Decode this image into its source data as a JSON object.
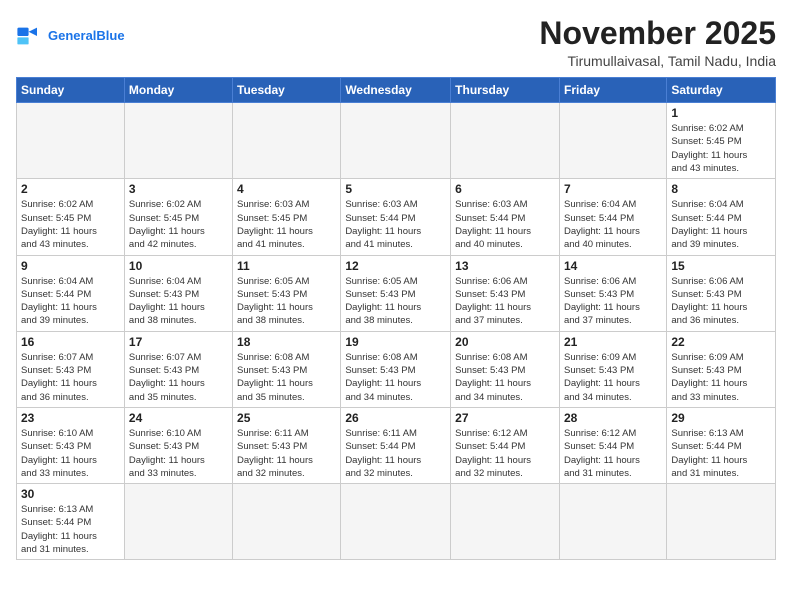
{
  "header": {
    "logo_general": "General",
    "logo_blue": "Blue",
    "month_title": "November 2025",
    "subtitle": "Tirumullaivasal, Tamil Nadu, India"
  },
  "weekdays": [
    "Sunday",
    "Monday",
    "Tuesday",
    "Wednesday",
    "Thursday",
    "Friday",
    "Saturday"
  ],
  "weeks": [
    [
      {
        "day": "",
        "info": ""
      },
      {
        "day": "",
        "info": ""
      },
      {
        "day": "",
        "info": ""
      },
      {
        "day": "",
        "info": ""
      },
      {
        "day": "",
        "info": ""
      },
      {
        "day": "",
        "info": ""
      },
      {
        "day": "1",
        "info": "Sunrise: 6:02 AM\nSunset: 5:45 PM\nDaylight: 11 hours\nand 43 minutes."
      }
    ],
    [
      {
        "day": "2",
        "info": "Sunrise: 6:02 AM\nSunset: 5:45 PM\nDaylight: 11 hours\nand 43 minutes."
      },
      {
        "day": "3",
        "info": "Sunrise: 6:02 AM\nSunset: 5:45 PM\nDaylight: 11 hours\nand 42 minutes."
      },
      {
        "day": "4",
        "info": "Sunrise: 6:03 AM\nSunset: 5:45 PM\nDaylight: 11 hours\nand 41 minutes."
      },
      {
        "day": "5",
        "info": "Sunrise: 6:03 AM\nSunset: 5:44 PM\nDaylight: 11 hours\nand 41 minutes."
      },
      {
        "day": "6",
        "info": "Sunrise: 6:03 AM\nSunset: 5:44 PM\nDaylight: 11 hours\nand 40 minutes."
      },
      {
        "day": "7",
        "info": "Sunrise: 6:04 AM\nSunset: 5:44 PM\nDaylight: 11 hours\nand 40 minutes."
      },
      {
        "day": "8",
        "info": "Sunrise: 6:04 AM\nSunset: 5:44 PM\nDaylight: 11 hours\nand 39 minutes."
      }
    ],
    [
      {
        "day": "9",
        "info": "Sunrise: 6:04 AM\nSunset: 5:44 PM\nDaylight: 11 hours\nand 39 minutes."
      },
      {
        "day": "10",
        "info": "Sunrise: 6:04 AM\nSunset: 5:43 PM\nDaylight: 11 hours\nand 38 minutes."
      },
      {
        "day": "11",
        "info": "Sunrise: 6:05 AM\nSunset: 5:43 PM\nDaylight: 11 hours\nand 38 minutes."
      },
      {
        "day": "12",
        "info": "Sunrise: 6:05 AM\nSunset: 5:43 PM\nDaylight: 11 hours\nand 38 minutes."
      },
      {
        "day": "13",
        "info": "Sunrise: 6:06 AM\nSunset: 5:43 PM\nDaylight: 11 hours\nand 37 minutes."
      },
      {
        "day": "14",
        "info": "Sunrise: 6:06 AM\nSunset: 5:43 PM\nDaylight: 11 hours\nand 37 minutes."
      },
      {
        "day": "15",
        "info": "Sunrise: 6:06 AM\nSunset: 5:43 PM\nDaylight: 11 hours\nand 36 minutes."
      }
    ],
    [
      {
        "day": "16",
        "info": "Sunrise: 6:07 AM\nSunset: 5:43 PM\nDaylight: 11 hours\nand 36 minutes."
      },
      {
        "day": "17",
        "info": "Sunrise: 6:07 AM\nSunset: 5:43 PM\nDaylight: 11 hours\nand 35 minutes."
      },
      {
        "day": "18",
        "info": "Sunrise: 6:08 AM\nSunset: 5:43 PM\nDaylight: 11 hours\nand 35 minutes."
      },
      {
        "day": "19",
        "info": "Sunrise: 6:08 AM\nSunset: 5:43 PM\nDaylight: 11 hours\nand 34 minutes."
      },
      {
        "day": "20",
        "info": "Sunrise: 6:08 AM\nSunset: 5:43 PM\nDaylight: 11 hours\nand 34 minutes."
      },
      {
        "day": "21",
        "info": "Sunrise: 6:09 AM\nSunset: 5:43 PM\nDaylight: 11 hours\nand 34 minutes."
      },
      {
        "day": "22",
        "info": "Sunrise: 6:09 AM\nSunset: 5:43 PM\nDaylight: 11 hours\nand 33 minutes."
      }
    ],
    [
      {
        "day": "23",
        "info": "Sunrise: 6:10 AM\nSunset: 5:43 PM\nDaylight: 11 hours\nand 33 minutes."
      },
      {
        "day": "24",
        "info": "Sunrise: 6:10 AM\nSunset: 5:43 PM\nDaylight: 11 hours\nand 33 minutes."
      },
      {
        "day": "25",
        "info": "Sunrise: 6:11 AM\nSunset: 5:43 PM\nDaylight: 11 hours\nand 32 minutes."
      },
      {
        "day": "26",
        "info": "Sunrise: 6:11 AM\nSunset: 5:44 PM\nDaylight: 11 hours\nand 32 minutes."
      },
      {
        "day": "27",
        "info": "Sunrise: 6:12 AM\nSunset: 5:44 PM\nDaylight: 11 hours\nand 32 minutes."
      },
      {
        "day": "28",
        "info": "Sunrise: 6:12 AM\nSunset: 5:44 PM\nDaylight: 11 hours\nand 31 minutes."
      },
      {
        "day": "29",
        "info": "Sunrise: 6:13 AM\nSunset: 5:44 PM\nDaylight: 11 hours\nand 31 minutes."
      }
    ],
    [
      {
        "day": "30",
        "info": "Sunrise: 6:13 AM\nSunset: 5:44 PM\nDaylight: 11 hours\nand 31 minutes."
      },
      {
        "day": "",
        "info": ""
      },
      {
        "day": "",
        "info": ""
      },
      {
        "day": "",
        "info": ""
      },
      {
        "day": "",
        "info": ""
      },
      {
        "day": "",
        "info": ""
      },
      {
        "day": "",
        "info": ""
      }
    ]
  ]
}
